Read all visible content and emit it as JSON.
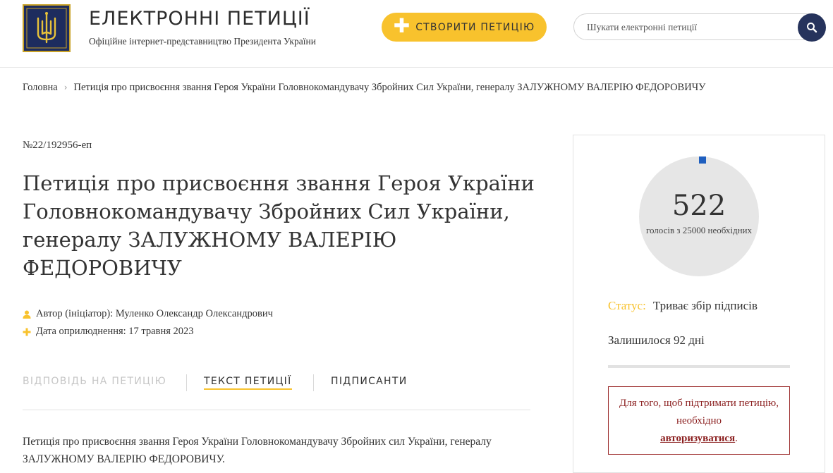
{
  "header": {
    "title": "ЕЛЕКТРОННІ ПЕТИЦІЇ",
    "subtitle": "Офіційне інтернет-представництво Президента України",
    "create_label": "СТВОРИТИ ПЕТИЦІЮ",
    "search_placeholder": "Шукати електронні петиції"
  },
  "breadcrumb": {
    "home": "Головна",
    "current": "Петиція про присвоєння звання Героя України Головнокомандувачу Збройних Сил України, генералу ЗАЛУЖНОМУ ВАЛЕРІЮ ФЕДОРОВИЧУ"
  },
  "petition": {
    "number": "№22/192956-еп",
    "title": "Петиція про присвоєння звання Героя України Головнокомандувачу Збройних Сил України, генералу ЗАЛУЖНОМУ ВАЛЕРІЮ ФЕДОРОВИЧУ",
    "author": "Автор (ініціатор): Муленко Олександр Олександрович",
    "date": "Дата оприлюднення: 17 травня 2023",
    "body": "Петиція про присвоєння звання Героя України Головнокомандувачу Збройних сил України, генералу ЗАЛУЖНОМУ ВАЛЕРІЮ ФЕДОРОВИЧУ."
  },
  "tabs": [
    {
      "label": "ВІДПОВІДЬ НА ПЕТИЦІЮ"
    },
    {
      "label": "ТЕКСТ ПЕТИЦІЇ"
    },
    {
      "label": "ПІДПИСАНТИ"
    }
  ],
  "sidebar": {
    "votes": "522",
    "votes_caption": "голосів з 25000 необхідних",
    "votes_fraction": 0.0209,
    "status_label": "Статус:",
    "status_value": "Триває збір підписів",
    "remaining": "Залишилося 92 дні",
    "auth_text_before": "Для того, щоб підтримати петицію, необхідно",
    "auth_link": "авторизуватися",
    "auth_text_after": "."
  },
  "colors": {
    "accent_yellow": "#f8c22d",
    "navy": "#26335c",
    "auth_red": "#8b1f1f",
    "gauge_blue": "#1f5fbf"
  },
  "icons": {
    "logo": "trident-emblem",
    "create": "plus-icon",
    "search": "search-icon",
    "author": "user-icon",
    "date": "plus-icon"
  }
}
